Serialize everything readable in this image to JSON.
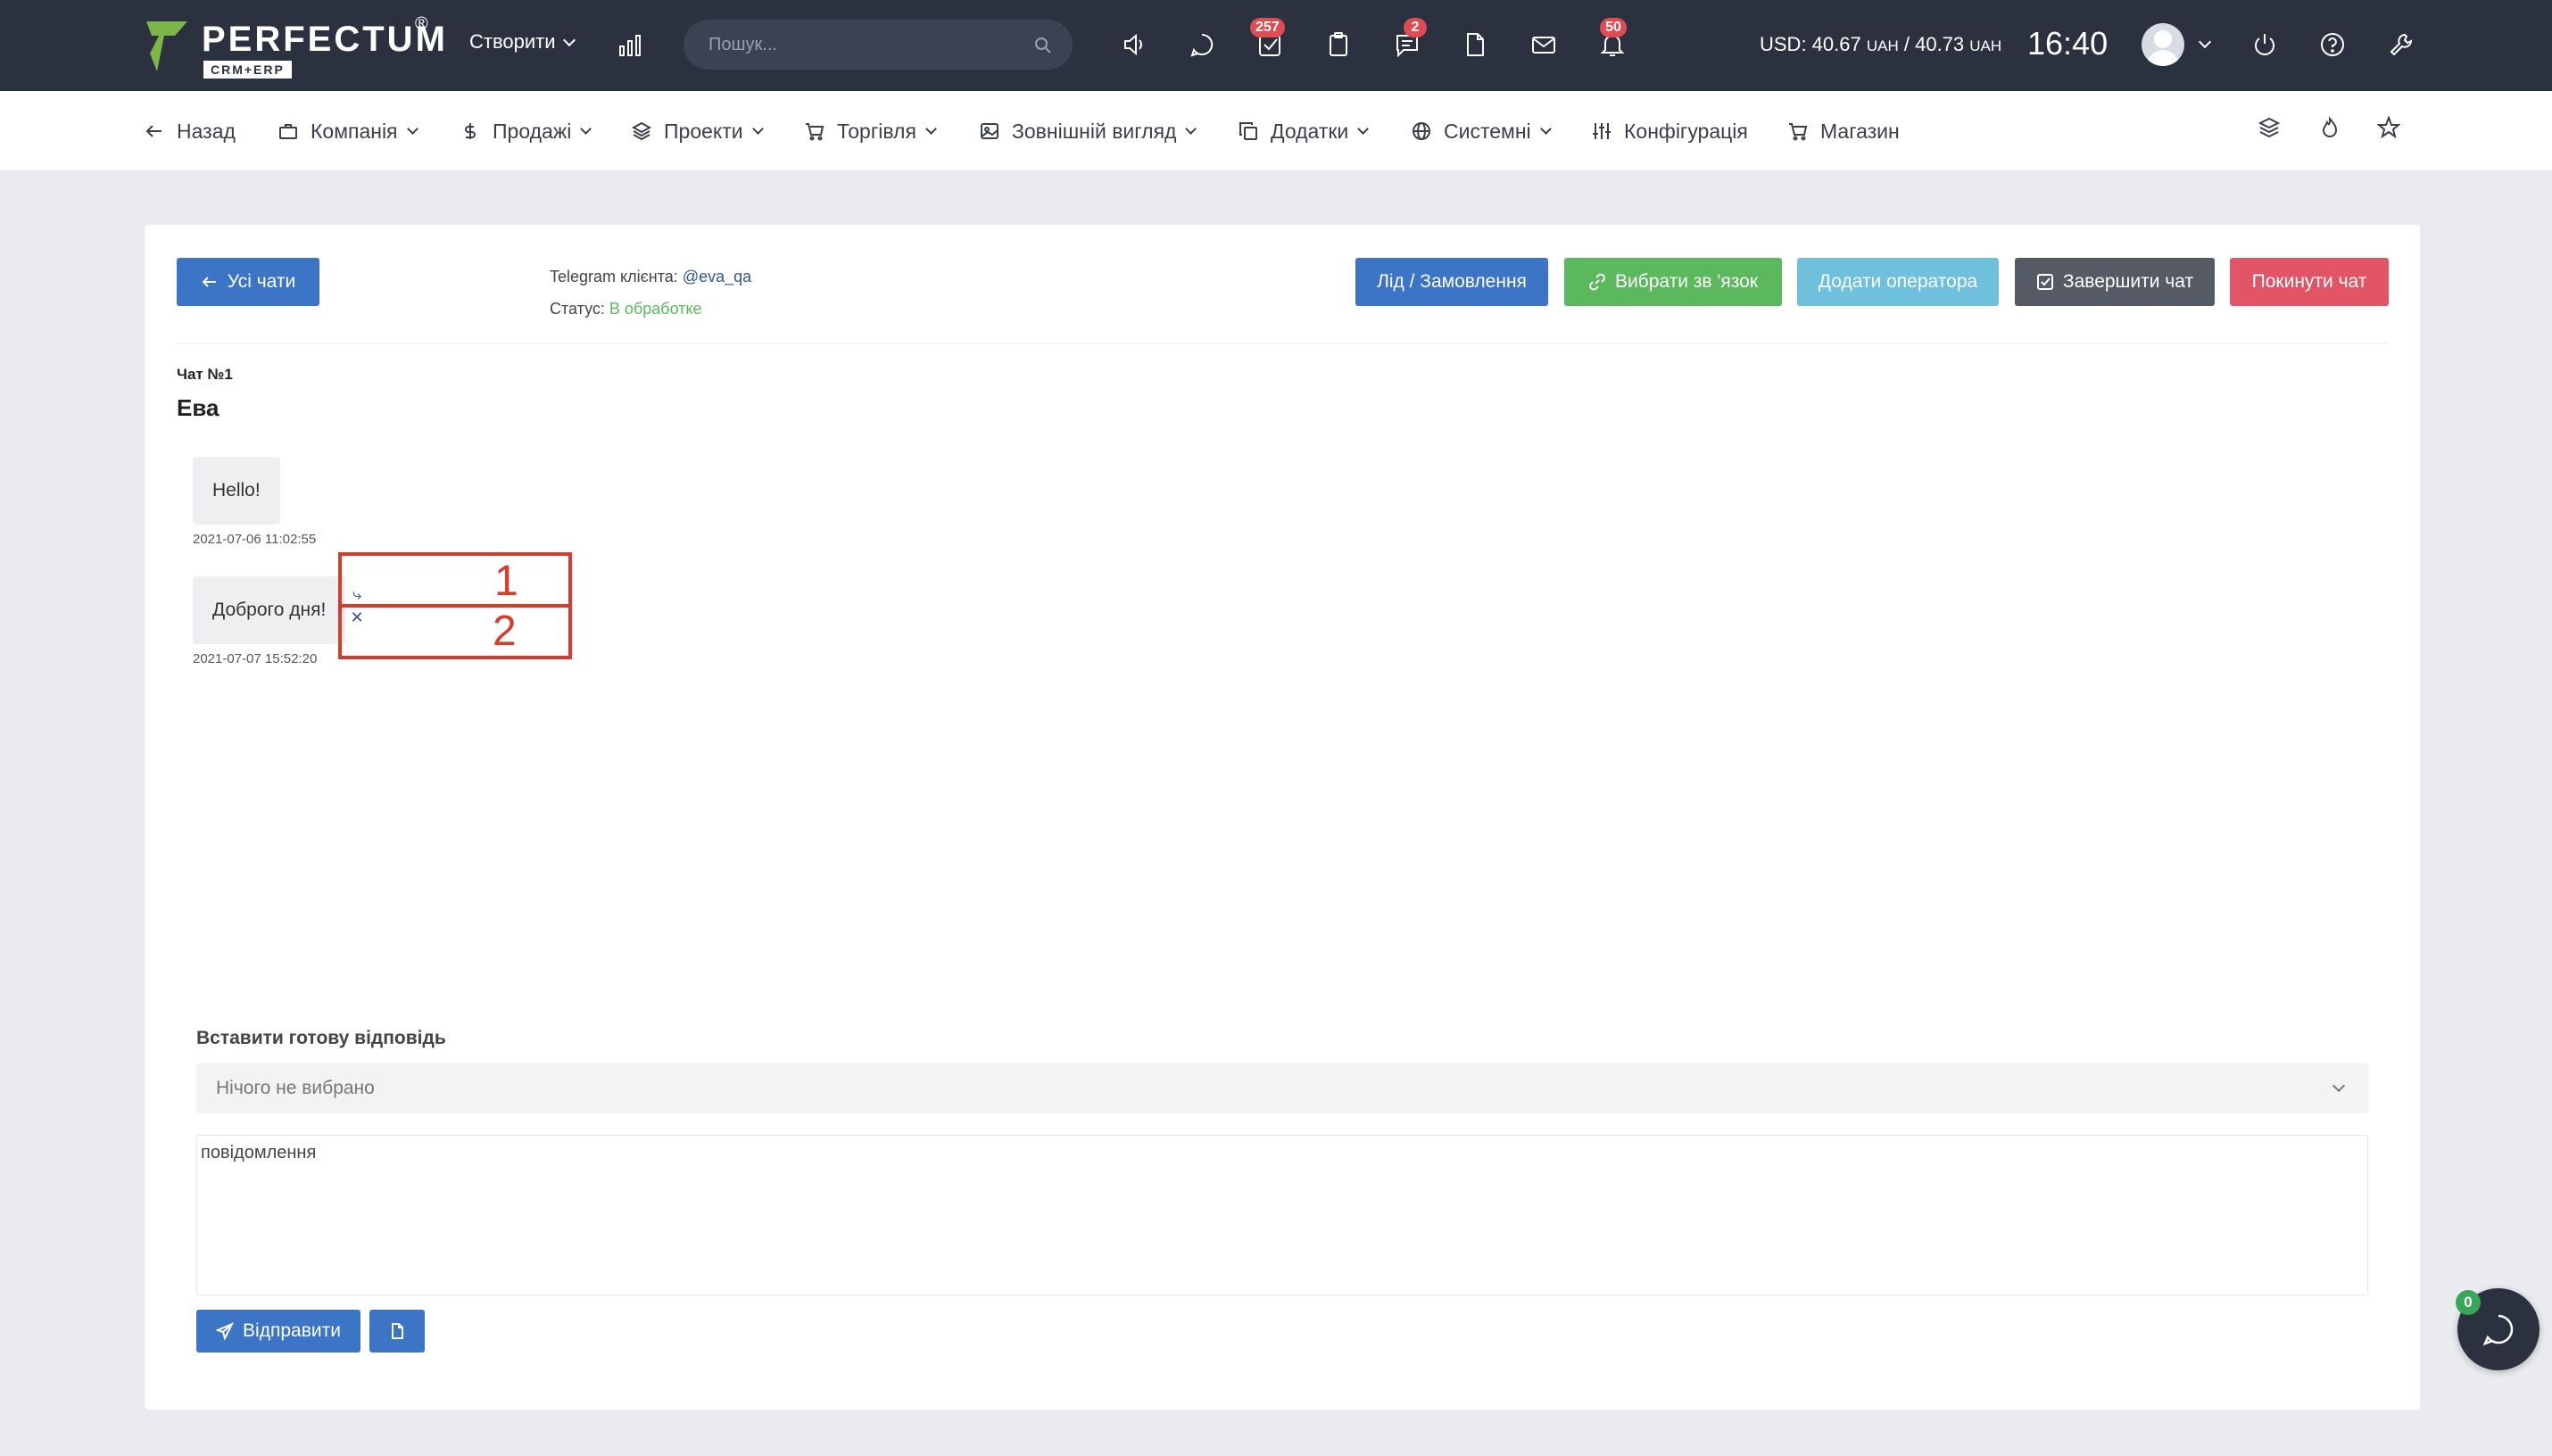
{
  "brand": {
    "name": "PERFECTUM",
    "sub": "CRM+ERP",
    "reg": "®",
    "mark_color": "#7ab648"
  },
  "topbar": {
    "create_label": "Створити",
    "search_placeholder": "Пошук...",
    "badges": {
      "tasks": "257",
      "comments": "2",
      "notifications": "50"
    },
    "currency_main": "USD: 40.67",
    "currency_unit1": "UAH",
    "currency_sep": " / 40.73",
    "currency_unit2": "UAH",
    "time": "16:40",
    "icons": [
      "chart-icon",
      "speaker-icon",
      "chat-icon",
      "tasks-icon",
      "clipboard-icon",
      "comments-icon",
      "file-icon",
      "mail-icon",
      "bell-icon",
      "power-icon",
      "help-icon",
      "wrench-icon"
    ]
  },
  "nav": {
    "items": [
      {
        "label": "Назад",
        "icon": "arrow-left-icon"
      },
      {
        "label": "Компанія",
        "icon": "briefcase-icon"
      },
      {
        "label": "Продажі",
        "icon": "dollar-icon"
      },
      {
        "label": "Проекти",
        "icon": "layers-icon"
      },
      {
        "label": "Торгівля",
        "icon": "cart-icon"
      },
      {
        "label": "Зовнішній вигляд",
        "icon": "image-icon"
      },
      {
        "label": "Додатки",
        "icon": "copy-icon"
      },
      {
        "label": "Системні",
        "icon": "globe-icon"
      },
      {
        "label": "Конфігурація",
        "icon": "sliders-icon"
      },
      {
        "label": "Магазин",
        "icon": "shop-cart-icon"
      }
    ]
  },
  "chat": {
    "back_label": "Усі чати",
    "telegram_label": "Telegram клієнта:",
    "telegram_user": "@eva_qa",
    "status_label": "Статус:",
    "status_value": "В обработке",
    "actions": {
      "lead": "Лід / Замовлення",
      "link": "Вибрати зв 'язок",
      "add_operator": "Додати оператора",
      "finish": "Завершити чат",
      "leave": "Покинути чат"
    },
    "number": "Чат №1",
    "name": "Ева",
    "messages": [
      {
        "text": "Hello!",
        "time": "2021-07-06 11:02:55"
      },
      {
        "text": "Доброго дня!",
        "time": "2021-07-07 15:52:20"
      }
    ],
    "annotations": {
      "first": "1",
      "second": "2"
    },
    "ready_reply_label": "Вставити готову відповідь",
    "ready_reply_value": "Нічого не вибрано",
    "message_placeholder": "повідомлення",
    "send_label": "Відправити"
  },
  "fab": {
    "badge": "0"
  },
  "colors": {
    "topbar": "#2c3140",
    "primary": "#3c74c6",
    "success": "#5cb85c",
    "info": "#6fc0dc",
    "dark": "#555b64",
    "danger": "#e25566",
    "annotation": "#d93a2b"
  }
}
